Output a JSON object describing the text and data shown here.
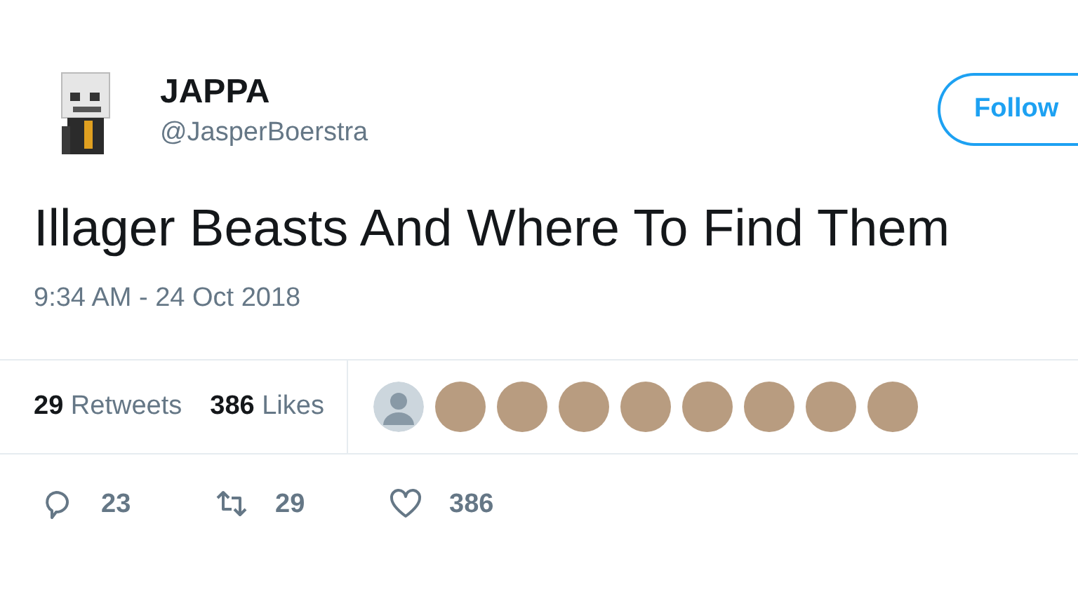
{
  "author": {
    "name": "JAPPA",
    "handle": "@JasperBoerstra"
  },
  "follow_button": {
    "label": "Follow"
  },
  "tweet": {
    "text": "Illager Beasts And Where To Find Them",
    "time": "9:34 AM - 24 Oct 2018"
  },
  "stats": [
    {
      "count": "29",
      "label": "Retweets"
    },
    {
      "count": "386",
      "label": "Likes"
    }
  ],
  "likers": [
    {
      "kind": "default"
    },
    {
      "kind": "photo"
    },
    {
      "kind": "photo"
    },
    {
      "kind": "photo"
    },
    {
      "kind": "photo"
    },
    {
      "kind": "photo"
    },
    {
      "kind": "photo"
    },
    {
      "kind": "photo"
    },
    {
      "kind": "photo"
    }
  ],
  "actions": [
    {
      "kind": "reply",
      "count": "23"
    },
    {
      "kind": "retweet",
      "count": "29"
    },
    {
      "kind": "like",
      "count": "386"
    }
  ]
}
